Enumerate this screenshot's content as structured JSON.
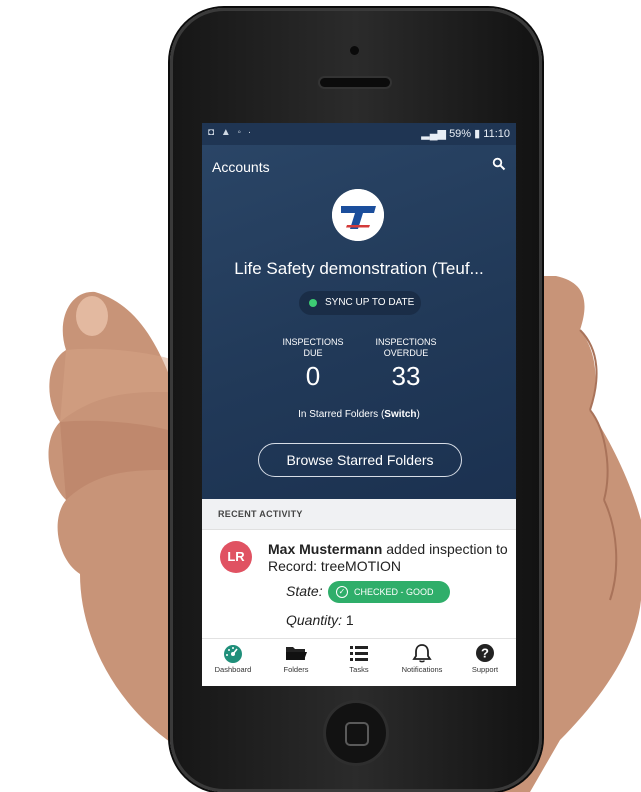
{
  "status_bar": {
    "battery": "59%",
    "time": "11:10"
  },
  "header": {
    "title": "Accounts",
    "search_icon": "search-icon"
  },
  "account": {
    "name": "Life Safety demonstration (Teuf...",
    "sync_status": "SYNC UP TO DATE"
  },
  "stats": [
    {
      "label": "INSPECTIONS\nDUE",
      "value": "0"
    },
    {
      "label": "INSPECTIONS\nOVERDUE",
      "value": "33"
    }
  ],
  "starred": {
    "prefix": "In Starred Folders (",
    "link": "Switch",
    "suffix": ")"
  },
  "browse_button": "Browse Starred Folders",
  "recent_activity": {
    "header": "RECENT ACTIVITY",
    "item": {
      "initials": "LR",
      "user": "Max Mustermann",
      "text": " added inspection to Record: treeMOTION",
      "state_label": "State:",
      "state_value": "CHECKED - GOOD",
      "quantity_label": "Quantity:",
      "quantity_value": " 1"
    }
  },
  "bottom_nav": [
    {
      "label": "Dashboard",
      "icon": "dashboard-icon",
      "active": true
    },
    {
      "label": "Folders",
      "icon": "folder-icon"
    },
    {
      "label": "Tasks",
      "icon": "list-icon"
    },
    {
      "label": "Notifications",
      "icon": "bell-icon"
    },
    {
      "label": "Support",
      "icon": "help-icon"
    }
  ],
  "colors": {
    "header_bg": "#213958",
    "status_green": "#2fae6a",
    "avatar": "#e05262",
    "accent_teal": "#1f8f7a"
  }
}
